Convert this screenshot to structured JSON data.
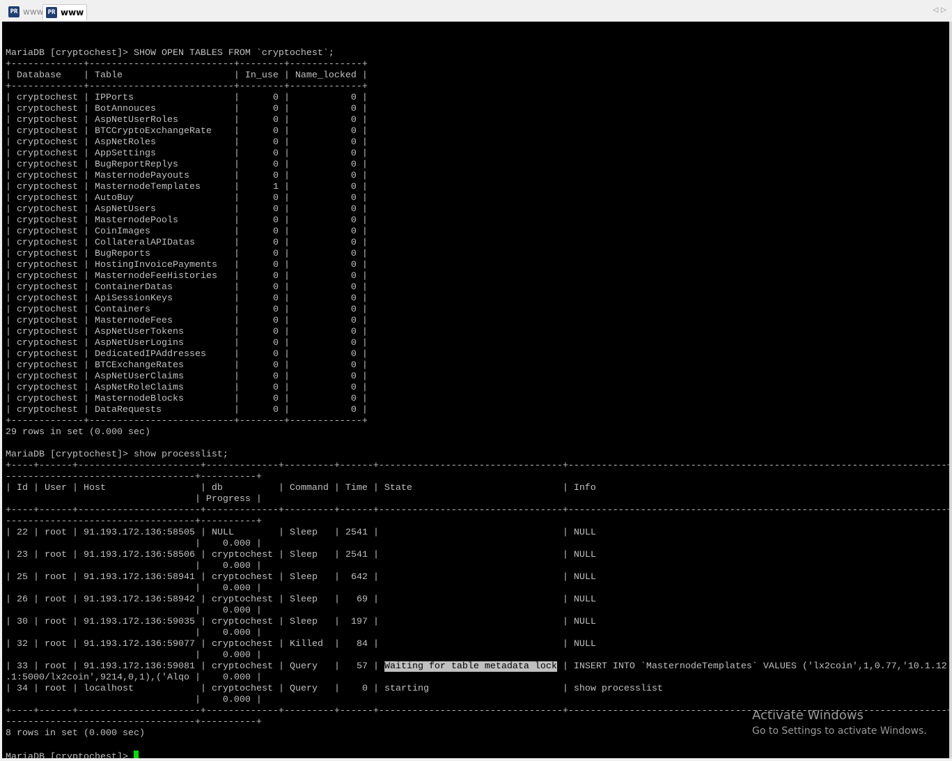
{
  "tabs": [
    {
      "label": "www",
      "icon": "putty-icon",
      "active": false
    },
    {
      "label": "www",
      "icon": "putty-icon",
      "active": true
    }
  ],
  "terminal": {
    "cmd1": "MariaDB [cryptochest]> SHOW OPEN TABLES FROM `cryptochest`;",
    "open_tables": {
      "columns": [
        "Database",
        "Table",
        "In_use",
        "Name_locked"
      ],
      "rows": [
        [
          "cryptochest",
          "IPPorts",
          "0",
          "0"
        ],
        [
          "cryptochest",
          "BotAnnouces",
          "0",
          "0"
        ],
        [
          "cryptochest",
          "AspNetUserRoles",
          "0",
          "0"
        ],
        [
          "cryptochest",
          "BTCCryptoExchangeRate",
          "0",
          "0"
        ],
        [
          "cryptochest",
          "AspNetRoles",
          "0",
          "0"
        ],
        [
          "cryptochest",
          "AppSettings",
          "0",
          "0"
        ],
        [
          "cryptochest",
          "BugReportReplys",
          "0",
          "0"
        ],
        [
          "cryptochest",
          "MasternodePayouts",
          "0",
          "0"
        ],
        [
          "cryptochest",
          "MasternodeTemplates",
          "1",
          "0"
        ],
        [
          "cryptochest",
          "AutoBuy",
          "0",
          "0"
        ],
        [
          "cryptochest",
          "AspNetUsers",
          "0",
          "0"
        ],
        [
          "cryptochest",
          "MasternodePools",
          "0",
          "0"
        ],
        [
          "cryptochest",
          "CoinImages",
          "0",
          "0"
        ],
        [
          "cryptochest",
          "CollateralAPIDatas",
          "0",
          "0"
        ],
        [
          "cryptochest",
          "BugReports",
          "0",
          "0"
        ],
        [
          "cryptochest",
          "HostingInvoicePayments",
          "0",
          "0"
        ],
        [
          "cryptochest",
          "MasternodeFeeHistories",
          "0",
          "0"
        ],
        [
          "cryptochest",
          "ContainerDatas",
          "0",
          "0"
        ],
        [
          "cryptochest",
          "ApiSessionKeys",
          "0",
          "0"
        ],
        [
          "cryptochest",
          "Containers",
          "0",
          "0"
        ],
        [
          "cryptochest",
          "MasternodeFees",
          "0",
          "0"
        ],
        [
          "cryptochest",
          "AspNetUserTokens",
          "0",
          "0"
        ],
        [
          "cryptochest",
          "AspNetUserLogins",
          "0",
          "0"
        ],
        [
          "cryptochest",
          "DedicatedIPAddresses",
          "0",
          "0"
        ],
        [
          "cryptochest",
          "BTCExchangeRates",
          "0",
          "0"
        ],
        [
          "cryptochest",
          "AspNetUserClaims",
          "0",
          "0"
        ],
        [
          "cryptochest",
          "AspNetRoleClaims",
          "0",
          "0"
        ],
        [
          "cryptochest",
          "MasternodeBlocks",
          "0",
          "0"
        ],
        [
          "cryptochest",
          "DataRequests",
          "0",
          "0"
        ]
      ]
    },
    "result1": "29 rows in set (0.000 sec)",
    "cmd2": "MariaDB [cryptochest]> show processlist;",
    "processlist": {
      "columns": [
        "Id",
        "User",
        "Host",
        "db",
        "Command",
        "Time",
        "State",
        "Info",
        "Progress"
      ],
      "rows": [
        {
          "id": "22",
          "user": "root",
          "host": "91.193.172.136:58505",
          "db": "NULL",
          "command": "Sleep",
          "time": "2541",
          "state": "",
          "info": "NULL",
          "info_wrap": "",
          "progress": "0.000"
        },
        {
          "id": "23",
          "user": "root",
          "host": "91.193.172.136:58506",
          "db": "cryptochest",
          "command": "Sleep",
          "time": "2541",
          "state": "",
          "info": "NULL",
          "info_wrap": "",
          "progress": "0.000"
        },
        {
          "id": "25",
          "user": "root",
          "host": "91.193.172.136:58941",
          "db": "cryptochest",
          "command": "Sleep",
          "time": "642",
          "state": "",
          "info": "NULL",
          "info_wrap": "",
          "progress": "0.000"
        },
        {
          "id": "26",
          "user": "root",
          "host": "91.193.172.136:58942",
          "db": "cryptochest",
          "command": "Sleep",
          "time": "69",
          "state": "",
          "info": "NULL",
          "info_wrap": "",
          "progress": "0.000"
        },
        {
          "id": "30",
          "user": "root",
          "host": "91.193.172.136:59035",
          "db": "cryptochest",
          "command": "Sleep",
          "time": "197",
          "state": "",
          "info": "NULL",
          "info_wrap": "",
          "progress": "0.000"
        },
        {
          "id": "32",
          "user": "root",
          "host": "91.193.172.136:59077",
          "db": "cryptochest",
          "command": "Killed",
          "time": "84",
          "state": "",
          "info": "NULL",
          "info_wrap": "",
          "progress": "0.000"
        },
        {
          "id": "33",
          "user": "root",
          "host": "91.193.172.136:59081",
          "db": "cryptochest",
          "command": "Query",
          "time": "57",
          "state": "Waiting for table metadata lock",
          "info": "INSERT INTO `MasternodeTemplates` VALUES ('lx2coin',1,0.77,'10.1.12",
          "info_wrap": ".1:5000/lx2coin',9214,0,1),('Alqo",
          "progress": "0.000"
        },
        {
          "id": "34",
          "user": "root",
          "host": "localhost",
          "db": "cryptochest",
          "command": "Query",
          "time": "0",
          "state": "starting",
          "info": "show processlist",
          "info_wrap": "",
          "progress": "0.000"
        }
      ]
    },
    "result2": "8 rows in set (0.000 sec)",
    "prompt": "MariaDB [cryptochest]> "
  },
  "watermark": {
    "title": "Activate Windows",
    "subtitle": "Go to Settings to activate Windows."
  },
  "colors": {
    "terminal_bg": "#000000",
    "terminal_fg": "#c0c0c0",
    "cursor": "#00e000",
    "selection_bg": "#c0c0c0"
  }
}
